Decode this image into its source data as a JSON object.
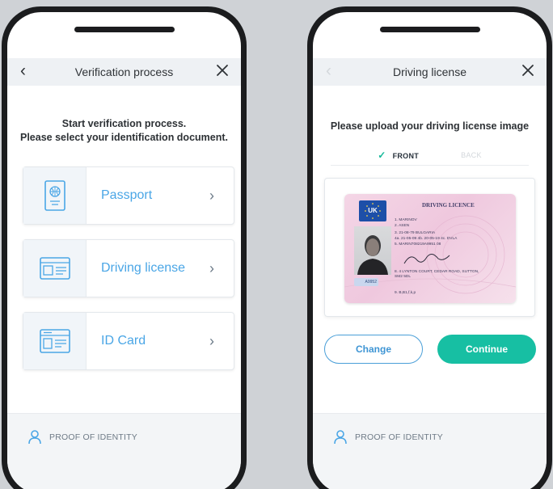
{
  "left_screen": {
    "title": "Verification process",
    "heading_line1": "Start verification process.",
    "heading_line2": "Please select your identification document.",
    "documents": [
      {
        "label": "Passport",
        "icon": "passport-icon"
      },
      {
        "label": "Driving license",
        "icon": "driving-license-icon"
      },
      {
        "label": "ID Card",
        "icon": "id-card-icon"
      }
    ],
    "footer_label": "PROOF OF IDENTITY"
  },
  "right_screen": {
    "title": "Driving license",
    "heading": "Please upload your driving license image",
    "tabs": {
      "front": "FRONT",
      "back": "BACK"
    },
    "license": {
      "country_code": "UK",
      "title": "DRIVING LICENCE",
      "lines": [
        "1.  MARINOV",
        "2.  ASEN",
        "3.  21-08-79 BULGARIA",
        "4a. 21-05-09   4b. 20-05-19   4c. DVLA",
        "5.  MARIN708219A9951 08",
        "8.  4 LYNTON COURT, CEDAR ROAD, SUTTON,",
        "     SM2 5DL",
        "9.  B,B1,f,k,p"
      ],
      "badge": "A9952"
    },
    "buttons": {
      "change": "Change",
      "continue": "Continue"
    },
    "footer_label": "PROOF OF IDENTITY"
  },
  "colors": {
    "accent_blue": "#4aa6e6",
    "accent_green": "#17bfa3",
    "phone_frame": "#1b1c1e"
  }
}
